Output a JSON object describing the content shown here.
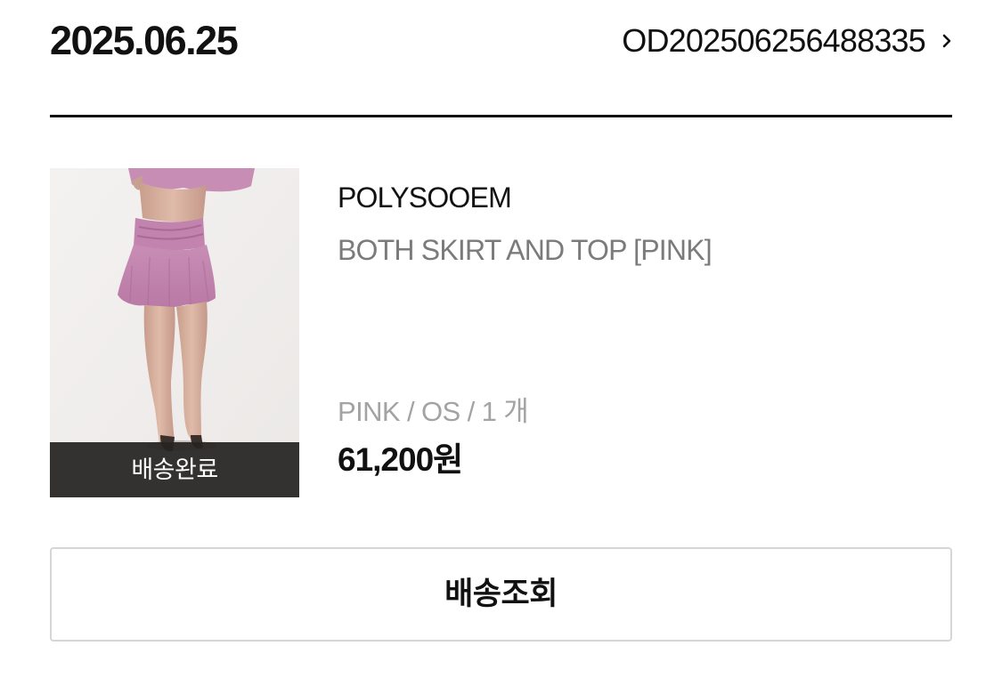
{
  "order": {
    "date": "2025.06.25",
    "number": "OD202506256488335",
    "detail_icon": "chevron-right-icon"
  },
  "item": {
    "image_alt": "product-photo",
    "status": "배송완료",
    "brand": "POLYSOOEM",
    "name": "BOTH SKIRT AND TOP [PINK]",
    "options": "PINK / OS / 1 개",
    "price": "61,200원"
  },
  "actions": {
    "track_label": "배송조회"
  },
  "colors": {
    "text_primary": "#111111",
    "text_secondary": "#7b7b7b",
    "text_muted": "#a3a3a3",
    "status_overlay": "#262321",
    "button_border": "#d6d6d6",
    "product_pink": "#c98fb6"
  }
}
